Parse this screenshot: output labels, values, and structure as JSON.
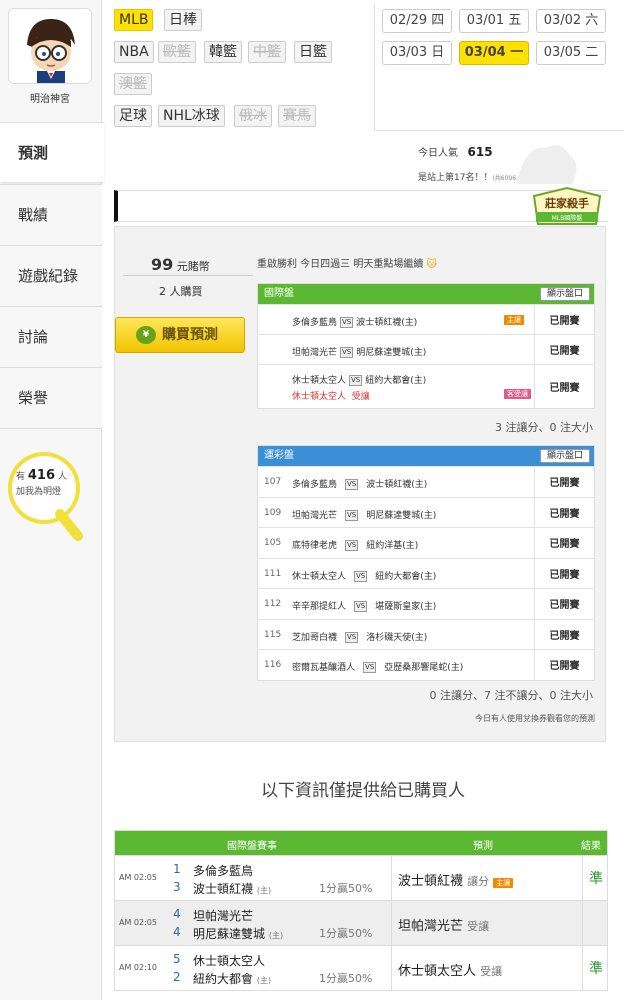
{
  "user": {
    "name": "明治神宮"
  },
  "nav": [
    "預測",
    "戰績",
    "遊戲紀錄",
    "討論",
    "榮譽"
  ],
  "bulb": {
    "prefix": "有",
    "count": "416",
    "unit": "人",
    "text": "加我為明燈"
  },
  "sports": {
    "row1": [
      {
        "label": "MLB",
        "state": "selected"
      },
      {
        "label": "日棒",
        "state": "normal"
      }
    ],
    "row2": [
      {
        "label": "NBA",
        "state": "normal"
      },
      {
        "label": "歐籃",
        "state": "disabled"
      },
      {
        "label": "韓籃",
        "state": "normal"
      },
      {
        "label": "中籃",
        "state": "disabled"
      },
      {
        "label": "日籃",
        "state": "normal"
      }
    ],
    "row3": [
      {
        "label": "澳籃",
        "state": "disabled"
      }
    ],
    "row4": [
      {
        "label": "足球",
        "state": "normal"
      },
      {
        "label": "NHL冰球",
        "state": "normal"
      },
      {
        "label": "俄冰",
        "state": "disabled"
      },
      {
        "label": "賽馬",
        "state": "disabled"
      }
    ]
  },
  "dates": [
    {
      "label": "02/29 四",
      "selected": false
    },
    {
      "label": "03/01 五",
      "selected": false
    },
    {
      "label": "03/02 六",
      "selected": false
    },
    {
      "label": "03/03 日",
      "selected": false
    },
    {
      "label": "03/04 一",
      "selected": true
    },
    {
      "label": "03/05 二",
      "selected": false
    }
  ],
  "popularity": {
    "label": "今日人氣",
    "value": "615",
    "rank": "是站上第17名！！",
    "rank_note": "(共6096人)"
  },
  "badge": {
    "title": "莊家殺手",
    "sub": "MLB國際盤"
  },
  "purchase": {
    "price": "99",
    "unit": "元賭幣",
    "buyers": "2",
    "buyers_unit": "人購買",
    "button": "購買預測"
  },
  "note": "重啟勝利 今日四過三 明天重點場繼續",
  "intl": {
    "title": "國際盤",
    "button": "顯示盤口",
    "rows": [
      {
        "away": "多倫多藍鳥",
        "home": "波士頓紅襪(主)",
        "label": "主讓",
        "status": "已開賽"
      },
      {
        "away": "坦帕灣光芒",
        "home": "明尼蘇達雙城(主)",
        "label": "",
        "status": "已開賽"
      },
      {
        "away": "休士頓太空人",
        "home": "紐約大都會(主)",
        "label": "",
        "status": "已開賽",
        "pick": "休士頓太空人",
        "pick_note": "受讓",
        "pink": "客受讓"
      }
    ],
    "summary": "3 注讓分、0 注大小"
  },
  "lottery": {
    "title": "運彩盤",
    "button": "顯示盤口",
    "rows": [
      {
        "num": "107",
        "away": "多倫多藍鳥",
        "home": "波士頓紅襪(主)",
        "status": "已開賽"
      },
      {
        "num": "109",
        "away": "坦帕灣光芒",
        "home": "明尼蘇達雙城(主)",
        "status": "已開賽"
      },
      {
        "num": "105",
        "away": "底特律老虎",
        "home": "紐約洋基(主)",
        "status": "已開賽"
      },
      {
        "num": "111",
        "away": "休士頓太空人",
        "home": "紐約大都會(主)",
        "status": "已開賽"
      },
      {
        "num": "112",
        "away": "辛辛那提紅人",
        "home": "堪薩斯皇家(主)",
        "status": "已開賽"
      },
      {
        "num": "115",
        "away": "芝加哥白襪",
        "home": "洛杉磯天使(主)",
        "status": "已開賽"
      },
      {
        "num": "116",
        "away": "密爾瓦基釀酒人",
        "home": "亞歷桑那響尾蛇(主)",
        "status": "已開賽"
      }
    ],
    "summary": "0 注讓分、7 注不讓分、0 注大小"
  },
  "coupon_note": "今日有人使用兌換券觀看您的預測",
  "buyers_only": "以下資訊僅提供給已購買人",
  "results": {
    "headers": [
      "國際盤賽事",
      "預測",
      "結果"
    ],
    "rows": [
      {
        "time": "AM 02:05",
        "n1": "1",
        "t1": "多倫多藍鳥",
        "n2": "3",
        "t2": "波士頓紅襪",
        "home": "(主)",
        "odds": "1分贏50%",
        "pick": "波士頓紅襪",
        "pick_note": "讓分",
        "tag": "主讓",
        "result": "準"
      },
      {
        "time": "AM 02:05",
        "n1": "4",
        "t1": "坦帕灣光芒",
        "n2": "4",
        "t2": "明尼蘇達雙城",
        "home": "(主)",
        "odds": "1分贏50%",
        "pick": "坦帕灣光芒",
        "pick_note": "受讓",
        "tag": "",
        "result": ""
      },
      {
        "time": "AM 02:10",
        "n1": "5",
        "t1": "休士頓太空人",
        "n2": "2",
        "t2": "紐約大都會",
        "home": "(主)",
        "odds": "1分贏50%",
        "pick": "休士頓太空人",
        "pick_note": "受讓",
        "tag": "",
        "result": "準"
      }
    ]
  },
  "colors": {
    "accent": "#ffe100",
    "green": "#5cb833",
    "blue": "#3a8fd6",
    "orange": "#f08a00"
  }
}
